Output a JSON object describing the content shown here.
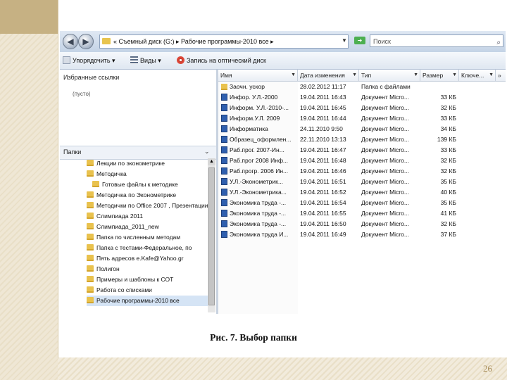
{
  "address": {
    "path": "« Съемный диск (G:) ▸ Рабочие программы-2010 все ▸",
    "search_placeholder": "Поиск"
  },
  "toolbar": {
    "organize": "Упорядочить ▾",
    "views": "Виды ▾",
    "burn": "Запись на оптический диск"
  },
  "favorites": {
    "title": "Избранные ссылки",
    "subtitle": "(пусто)"
  },
  "folders": {
    "title": "Папки",
    "items": [
      "Лекции по эконометрике",
      "Методичка",
      "Готовые файлы к методике",
      "Методичка по Эконометрике",
      "Методички по Office 2007 , Презентации",
      "Слимпиада 2011",
      "Слимпиада_2011_new",
      "Папка по численным методам",
      "Папка с тестами-Федеральное, по",
      "Пять адресов e.Kafe@Yahoo.gr",
      "Полигон",
      "Примеры и шаблоны к СОТ",
      "Работа со списками",
      "Рабочие программы-2010 все"
    ]
  },
  "columns": {
    "name": "Имя",
    "date": "Дата изменения",
    "type": "Тип",
    "size": "Размер",
    "keywords": "Ключе..."
  },
  "files": [
    {
      "name": "Заочн. ускор",
      "date": "28.02.2012 11:17",
      "type": "Папка с файлами",
      "size": "",
      "kind": "folder"
    },
    {
      "name": "Инфор. У.Л.-2000",
      "date": "19.04.2011 16:43",
      "type": "Документ Micro...",
      "size": "33 КБ",
      "kind": "doc"
    },
    {
      "name": "Информ. У.Л.-2010-...",
      "date": "19.04.2011 16:45",
      "type": "Документ Micro...",
      "size": "32 КБ",
      "kind": "doc"
    },
    {
      "name": "Информ.У.Л. 2009",
      "date": "19.04.2011 16:44",
      "type": "Документ Micro...",
      "size": "33 КБ",
      "kind": "doc"
    },
    {
      "name": "Информатика",
      "date": "24.11.2010 9:50",
      "type": "Документ Micro...",
      "size": "34 КБ",
      "kind": "doc"
    },
    {
      "name": "Образец_оформлен...",
      "date": "22.11.2010 13:13",
      "type": "Документ Micro...",
      "size": "139 КБ",
      "kind": "doc"
    },
    {
      "name": "Раб.прог. 2007-Ин...",
      "date": "19.04.2011 16:47",
      "type": "Документ Micro...",
      "size": "33 КБ",
      "kind": "doc"
    },
    {
      "name": "Раб.прог 2008 Инф...",
      "date": "19.04.2011 16:48",
      "type": "Документ Micro...",
      "size": "32 КБ",
      "kind": "doc"
    },
    {
      "name": "Раб.прогр. 2006 Ин...",
      "date": "19.04.2011 16:46",
      "type": "Документ Micro...",
      "size": "32 КБ",
      "kind": "doc"
    },
    {
      "name": "У.Л.-Эконометрик...",
      "date": "19.04.2011 16:51",
      "type": "Документ Micro...",
      "size": "35 КБ",
      "kind": "doc"
    },
    {
      "name": "У.Л.-Эконометрика...",
      "date": "19.04.2011 16:52",
      "type": "Документ Micro...",
      "size": "40 КБ",
      "kind": "doc"
    },
    {
      "name": "Экономика труда -...",
      "date": "19.04.2011 16:54",
      "type": "Документ Micro...",
      "size": "35 КБ",
      "kind": "doc"
    },
    {
      "name": "Экономика труда -...",
      "date": "19.04.2011 16:55",
      "type": "Документ Micro...",
      "size": "41 КБ",
      "kind": "doc"
    },
    {
      "name": "Экономика труда -...",
      "date": "19.04.2011 16:50",
      "type": "Документ Micro...",
      "size": "32 КБ",
      "kind": "doc"
    },
    {
      "name": "Экономика труда И...",
      "date": "19.04.2011 16:49",
      "type": "Документ Micro...",
      "size": "37 КБ",
      "kind": "doc"
    }
  ],
  "caption": "Рис. 7. Выбор папки",
  "page_number": "26"
}
